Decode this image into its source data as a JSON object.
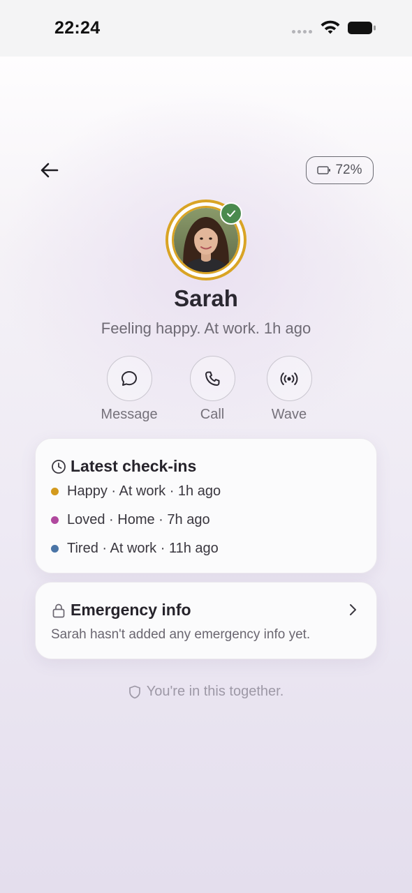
{
  "status_bar": {
    "time": "22:24"
  },
  "header": {
    "battery": "72%"
  },
  "profile": {
    "name": "Sarah",
    "status": "Feeling happy. At work. 1h ago"
  },
  "actions": [
    {
      "label": "Message",
      "icon": "chat-bubble-icon"
    },
    {
      "label": "Call",
      "icon": "phone-icon"
    },
    {
      "label": "Wave",
      "icon": "broadcast-icon"
    }
  ],
  "checkins": {
    "title": "Latest check-ins",
    "items": [
      {
        "text": "Happy · At work · 1h ago",
        "color": "#d39a1e"
      },
      {
        "text": "Loved · Home · 7h ago",
        "color": "#b0489e"
      },
      {
        "text": "Tired · At work · 11h ago",
        "color": "#4a74a6"
      }
    ]
  },
  "emergency": {
    "title": "Emergency info",
    "subtitle": "Sarah hasn't added any emergency info yet."
  },
  "footer": {
    "note": "You're in this together."
  },
  "colors": {
    "avatar_ring": "#d9a425",
    "check_badge": "#4a8a4e"
  }
}
